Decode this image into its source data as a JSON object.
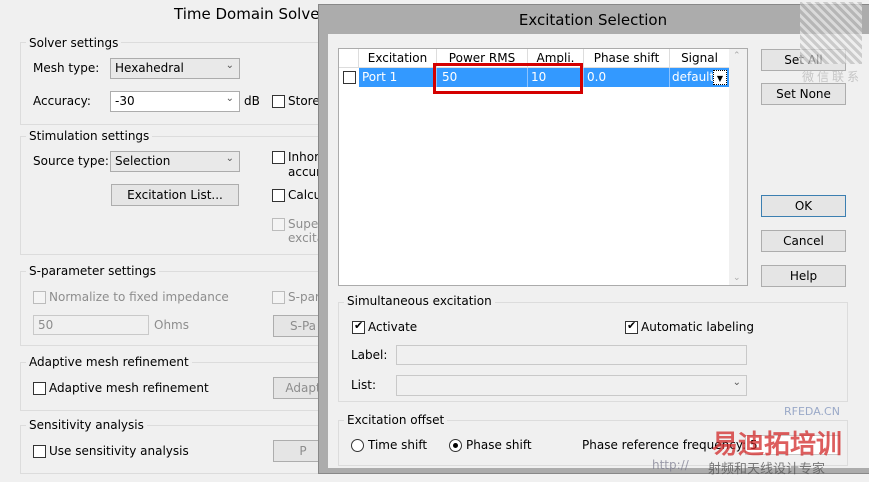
{
  "bg_dialog": {
    "title": "Time Domain Solver",
    "solver": {
      "title": "Solver settings",
      "mesh_label": "Mesh type:",
      "mesh_value": "Hexahedral",
      "accuracy_label": "Accuracy:",
      "accuracy_value": "-30",
      "db": "dB",
      "store": "Store"
    },
    "stim": {
      "title": "Stimulation settings",
      "source_label": "Source type:",
      "source_value": "Selection",
      "excitation_list": "Excitation List...",
      "inhom1": "Inhom",
      "inhom2": "accur",
      "calc": "Calcu",
      "super1": "Super",
      "super2": "excita"
    },
    "spar": {
      "title": "S-parameter settings",
      "normalize": "Normalize to fixed impedance",
      "spara": "S-para",
      "impedance": "50",
      "ohms": "Ohms",
      "spa_btn": "S-Pa"
    },
    "adaptive": {
      "title": "Adaptive mesh refinement",
      "check": "Adaptive mesh refinement",
      "btn": "Adapt"
    },
    "sens": {
      "title": "Sensitivity analysis",
      "check": "Use sensitivity analysis",
      "btn": "P"
    }
  },
  "dialog": {
    "title": "Excitation Selection",
    "table": {
      "headers": [
        "Excitation",
        "Power RMS",
        "Ampli.",
        "Phase shift",
        "Signal"
      ],
      "rows": [
        {
          "excitation": "Port 1",
          "power": "50",
          "ampli": "10",
          "phase": "0.0",
          "signal": "default"
        }
      ]
    },
    "buttons": {
      "set_all": "Set All",
      "set_none": "Set None",
      "ok": "OK",
      "cancel": "Cancel",
      "help": "Help"
    },
    "simul": {
      "title": "Simultaneous excitation",
      "activate": "Activate",
      "auto": "Automatic labeling",
      "label": "Label:",
      "list": "List:"
    },
    "offset": {
      "title": "Excitation offset",
      "time_shift": "Time shift",
      "phase_shift": "Phase shift",
      "freq_label": "Phase reference frequency:",
      "freq_value": "5"
    }
  },
  "watermark": {
    "wechat": "微信联系",
    "site": "RFEDA.CN",
    "brand": "易迪拓培训",
    "slogan": "射频和天线设计专家",
    "url": "http://"
  },
  "colors": {
    "selection": "#3399ff",
    "highlight": "#d40000"
  }
}
